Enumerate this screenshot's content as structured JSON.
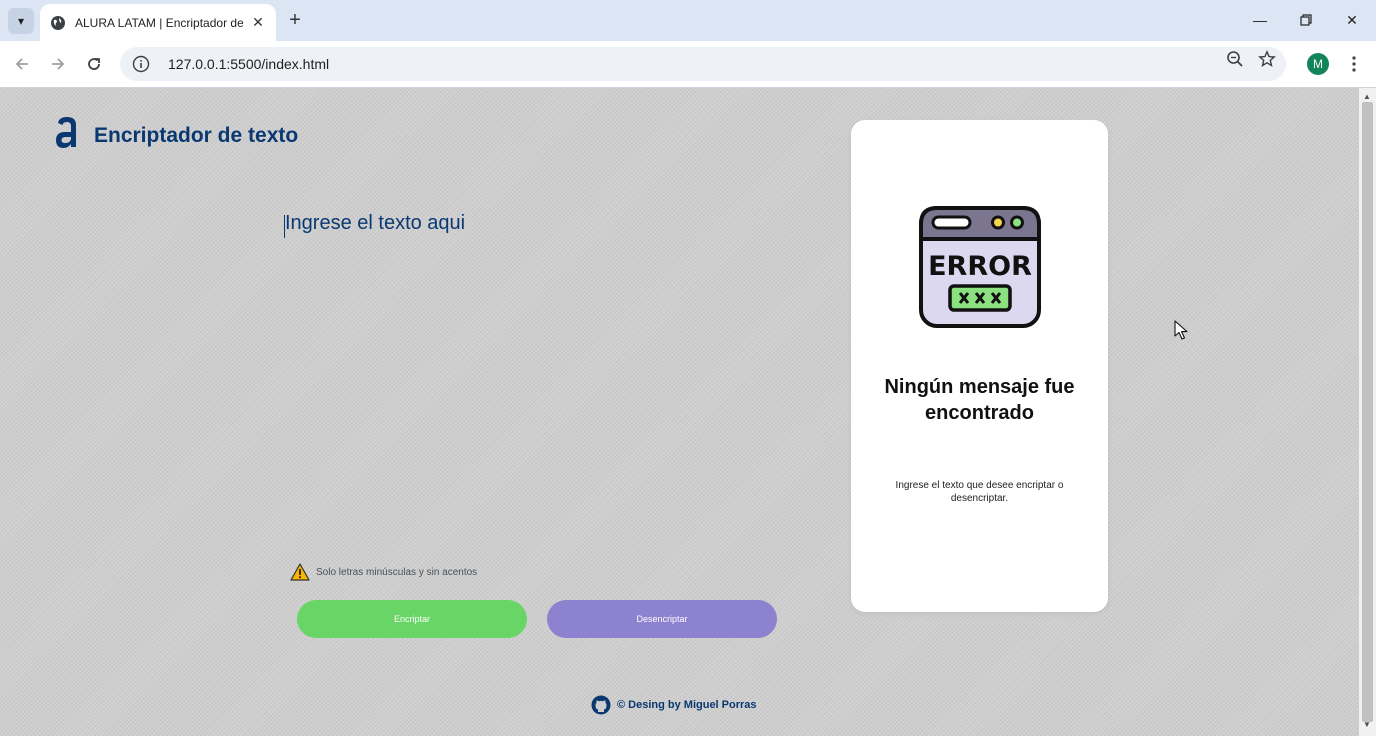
{
  "browser": {
    "tab_title": "ALURA LATAM | Encriptador de",
    "url": "127.0.0.1:5500/index.html",
    "profile_initial": "M",
    "accent_color": "#12855c"
  },
  "app": {
    "title": "Encriptador de texto",
    "brand_color": "#0a3871"
  },
  "input": {
    "placeholder": "Ingrese el texto aqui",
    "value": ""
  },
  "warning": {
    "text": "Solo letras minúsculas y sin acentos"
  },
  "buttons": {
    "encrypt_label": "Encriptar",
    "decrypt_label": "Desencriptar",
    "encrypt_color": "#69d566",
    "decrypt_color": "#8d82cf"
  },
  "result": {
    "illustration_text": "ERROR",
    "title": "Ningún mensaje fue encontrado",
    "message": "Ingrese el texto que desee encriptar o desencriptar."
  },
  "footer": {
    "text": "© Desing by Miguel Porras"
  }
}
